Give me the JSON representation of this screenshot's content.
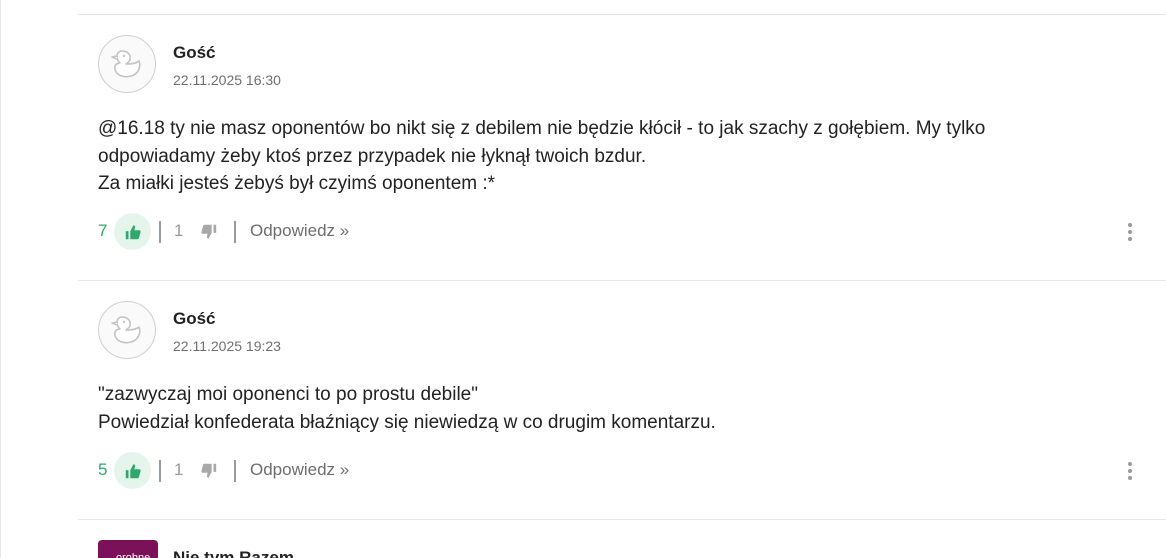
{
  "comments": [
    {
      "author": "Gość",
      "date": "22.11.2025 16:30",
      "lines": [
        "@16.18 ty nie masz oponentów bo nikt się z debilem nie będzie kłócił - to jak szachy z gołębiem. My tylko odpowiadamy żeby ktoś przez przypadek nie łyknął twoich bzdur.",
        "Za miałki jesteś żebyś był czyimś oponentem :*"
      ],
      "upvotes": "7",
      "downvotes": "1",
      "reply_label": "Odpowiedz »",
      "avatar_icon": "duck-icon",
      "upvote_icon": "thumbs-up-icon",
      "downvote_icon": "thumbs-down-icon",
      "menu_icon": "vertical-dots-icon"
    },
    {
      "author": "Gość",
      "date": "22.11.2025 19:23",
      "lines": [
        "\"zazwyczaj moi oponenci to po prostu debile\"",
        "Powiedział konfederata błaźniący się niewiedzą w co drugim komentarzu."
      ],
      "upvotes": "5",
      "downvotes": "1",
      "reply_label": "Odpowiedz »",
      "avatar_icon": "duck-icon",
      "upvote_icon": "thumbs-up-icon",
      "downvote_icon": "thumbs-down-icon",
      "menu_icon": "vertical-dots-icon"
    },
    {
      "author": "Nie tym Razem",
      "avatar_text": "orobne"
    }
  ],
  "colors": {
    "upvote_accent": "#2ea96b",
    "upvote_bg": "#e5f5ec",
    "avatar3_bg": "#7b1158",
    "divider": "#e6e6e6"
  }
}
